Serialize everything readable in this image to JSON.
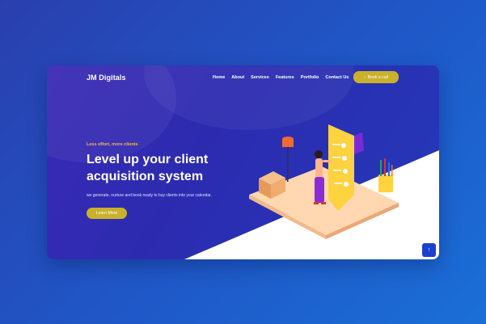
{
  "brand": {
    "name": "JM Digitals"
  },
  "nav": {
    "items": [
      "Home",
      "About",
      "Services",
      "Features",
      "Portfolio",
      "Contact Us"
    ]
  },
  "cta": {
    "call_label": "Book a call"
  },
  "hero": {
    "eyebrow": "Less effort, more clients",
    "headline": "Level up your client acquisition system",
    "subtext": "we generate, nurture and book ready to buy clients into your calendar.",
    "button_label": "Learn More"
  },
  "icons": {
    "cta": "chevron-right-icon",
    "scroll_top": "arrow-up-icon"
  },
  "colors": {
    "accent": "#c9b12a",
    "eyebrow": "#f2b84b",
    "card_bg": "#2c2bb0",
    "scroll_top_bg": "#1c3fd1"
  }
}
